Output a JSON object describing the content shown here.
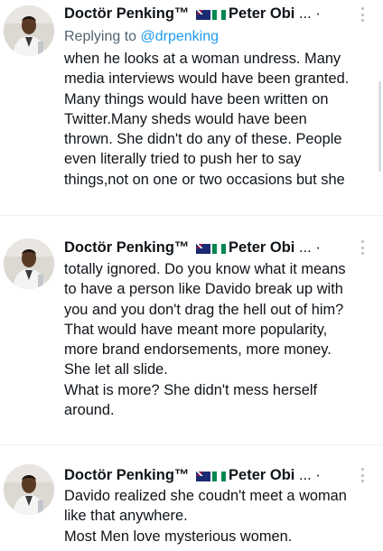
{
  "tweets": [
    {
      "author_name": "Doctör Penking™",
      "flags": [
        "australia-flag",
        "nigeria-flag"
      ],
      "author_handle": "Peter Obi",
      "truncation": "...",
      "separator_dot": "·",
      "replying_prefix": "Replying to",
      "replying_to": "@drpenking",
      "lines": [
        "when he looks at a woman undress. Many",
        "media interviews would have been granted.",
        "Many things would have been written on",
        "Twitter.Many sheds would have been",
        "thrown. She didn't do any of these. People",
        "even literally tried to push her to say",
        "things,not on one or two occasions but she"
      ]
    },
    {
      "author_name": "Doctör Penking™",
      "flags": [
        "australia-flag",
        "nigeria-flag"
      ],
      "author_handle": "Peter Obi",
      "truncation": "...",
      "separator_dot": "·",
      "lines": [
        "totally ignored. Do you know what it means",
        "to have a person like Davido break up with",
        "you and you don't drag the hell out of him?",
        "That would have meant more popularity,",
        "more brand endorsements, more money.",
        "She let all slide.",
        "What is more? She didn't mess herself",
        "around."
      ]
    },
    {
      "author_name": "Doctör Penking™",
      "flags": [
        "australia-flag",
        "nigeria-flag"
      ],
      "author_handle": "Peter Obi",
      "truncation": "...",
      "separator_dot": "·",
      "lines": [
        "Davido realized she coudn't meet a woman",
        "like that anywhere.",
        "Most Men love mysterious women."
      ]
    }
  ]
}
